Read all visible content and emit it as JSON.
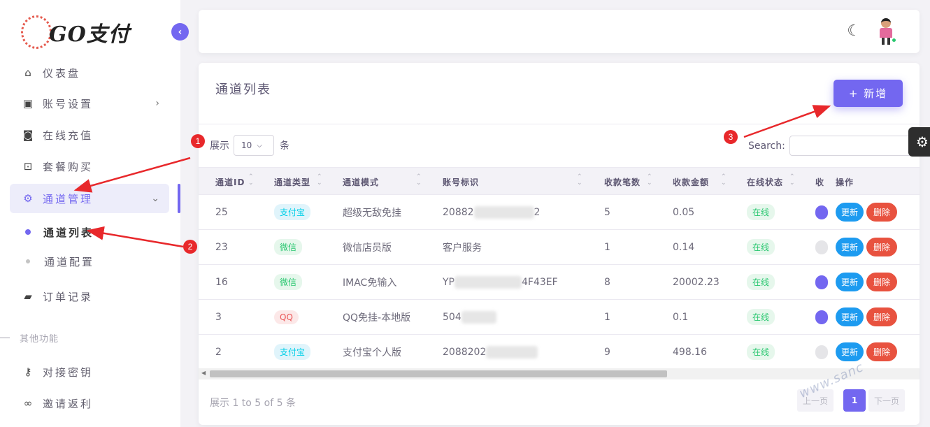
{
  "brand": {
    "name": "GO支付"
  },
  "sidebar": {
    "items": [
      {
        "label": "仪表盘",
        "icon": "home-icon"
      },
      {
        "label": "账号设置",
        "icon": "account-box-icon"
      },
      {
        "label": "在线充值",
        "icon": "camera-icon"
      },
      {
        "label": "套餐购买",
        "icon": "shopping-bag-icon"
      },
      {
        "label": "通道管理",
        "icon": "gear-icon"
      },
      {
        "label": "订单记录",
        "icon": "wallet-icon"
      }
    ],
    "sub_items": [
      {
        "label": "通道列表"
      },
      {
        "label": "通道配置"
      }
    ],
    "section_label": "其他功能",
    "extra_items": [
      {
        "label": "对接密钥",
        "icon": "key-icon"
      },
      {
        "label": "邀请返利",
        "icon": "link-icon"
      }
    ]
  },
  "card": {
    "title": "通道列表",
    "add_button": "+ 新增",
    "length_prefix": "展示",
    "length_value": "10",
    "length_suffix": "条",
    "search_label": "Search:"
  },
  "table": {
    "headers": [
      "通道ID",
      "通道类型",
      "通道模式",
      "账号标识",
      "收款笔数",
      "收款金额",
      "在线状态",
      "收",
      "操作"
    ],
    "rows": [
      {
        "id": "25",
        "type": "支付宝",
        "type_color": "blue",
        "mode": "超级无敌免挂",
        "account_start": "20882",
        "account_end": "2",
        "count": "5",
        "amount": "0.05",
        "status": "在线",
        "toggle": "on"
      },
      {
        "id": "23",
        "type": "微信",
        "type_color": "green",
        "mode": "微信店员版",
        "account_start": "客户服务",
        "account_end": "",
        "count": "1",
        "amount": "0.14",
        "status": "在线",
        "toggle": "off"
      },
      {
        "id": "16",
        "type": "微信",
        "type_color": "green",
        "mode": "IMAC免输入",
        "account_start": "YP",
        "account_end": "4F43EF",
        "count": "8",
        "amount": "20002.23",
        "status": "在线",
        "toggle": "on"
      },
      {
        "id": "3",
        "type": "QQ",
        "type_color": "red",
        "mode": "QQ免挂-本地版",
        "account_start": "504",
        "account_end": "",
        "count": "1",
        "amount": "0.1",
        "status": "在线",
        "toggle": "on"
      },
      {
        "id": "2",
        "type": "支付宝",
        "type_color": "blue",
        "mode": "支付宝个人版",
        "account_start": "2088202",
        "account_end": "",
        "count": "9",
        "amount": "498.16",
        "status": "在线",
        "toggle": "off"
      }
    ],
    "update_label": "更新",
    "delete_label": "删除"
  },
  "footer": {
    "info": "展示 1 to 5 of 5 条",
    "prev": "上一页",
    "current_page": "1",
    "next": "下一页"
  },
  "watermark": "www.sanc",
  "annotations": [
    "1",
    "2",
    "3"
  ],
  "colors": {
    "primary": "#7367f0",
    "update": "#1d9bf0",
    "delete": "#e8523f",
    "marker": "#e8282b"
  }
}
